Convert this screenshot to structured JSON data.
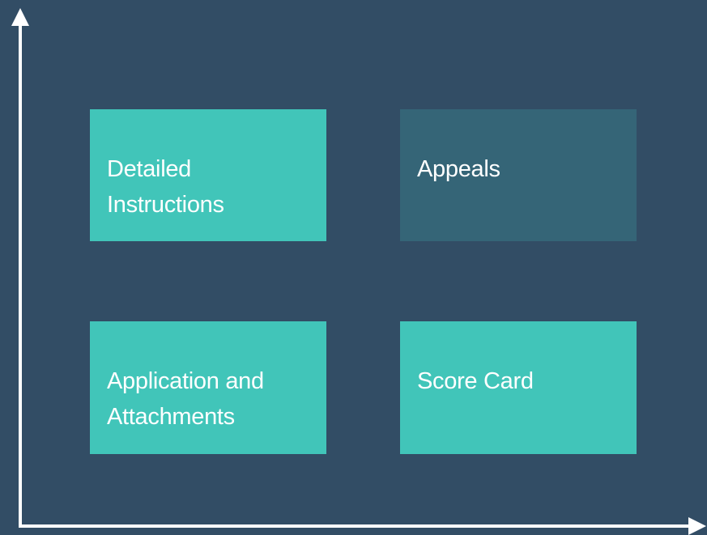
{
  "colors": {
    "background": "#324d65",
    "axis": "#ffffff",
    "box_active": "#41c5b9",
    "box_muted": "#356577",
    "text": "#ffffff"
  },
  "quadrants": {
    "top_left": {
      "label": "Detailed\nInstructions",
      "state": "active"
    },
    "top_right": {
      "label": "Appeals",
      "state": "muted"
    },
    "bottom_left": {
      "label": "Application and\nAttachments",
      "state": "active"
    },
    "bottom_right": {
      "label": "Score Card",
      "state": "active"
    }
  }
}
